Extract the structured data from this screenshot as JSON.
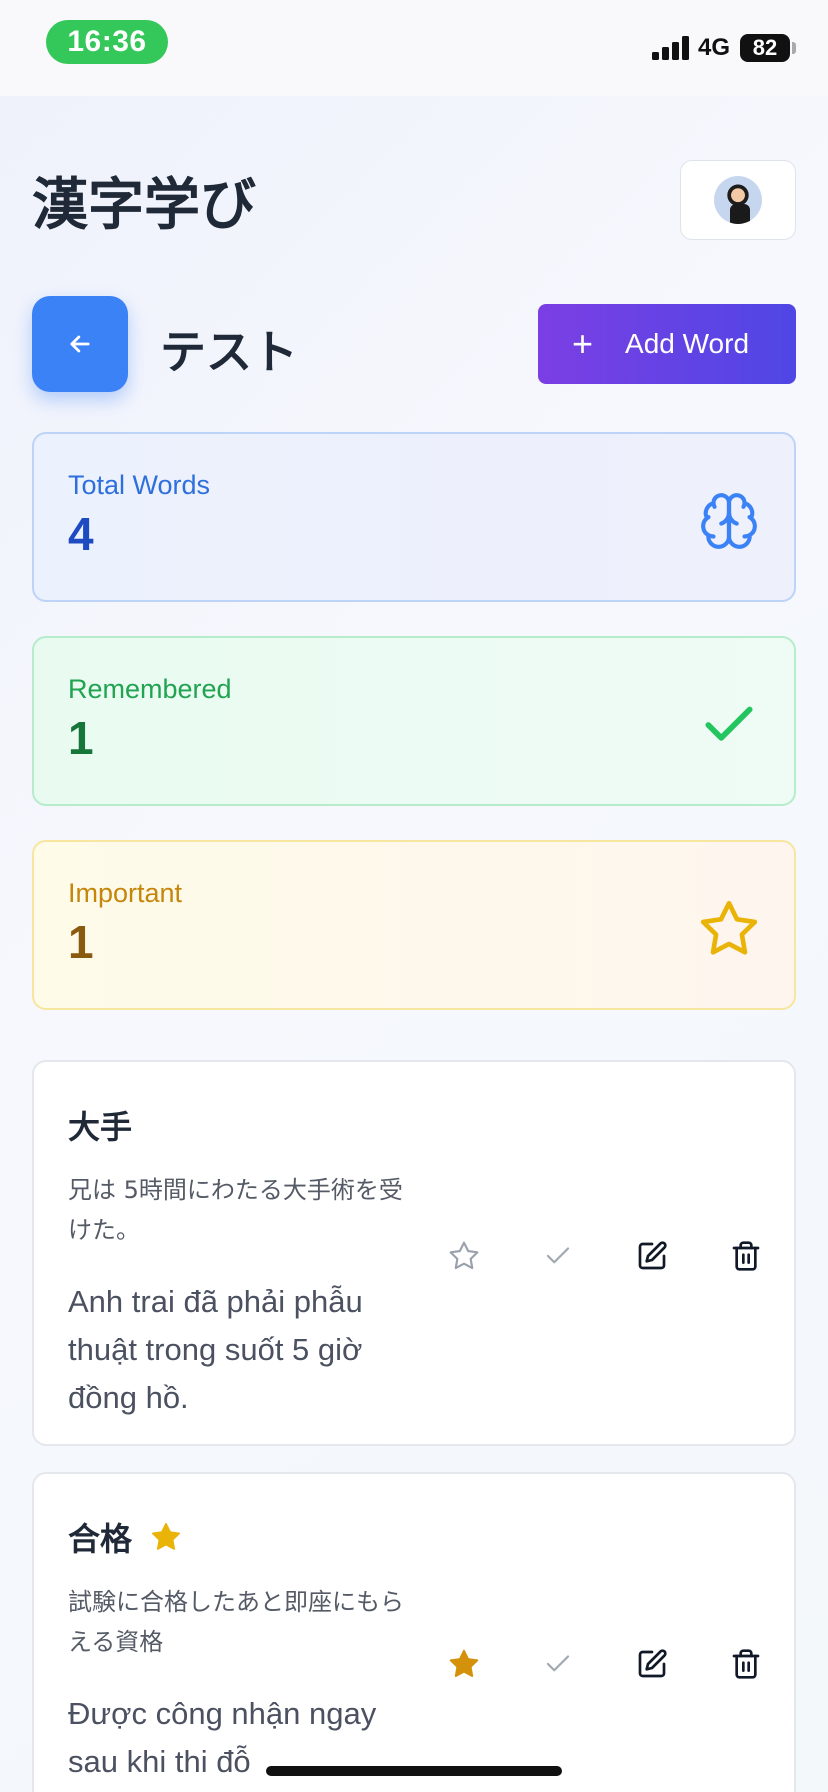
{
  "status_bar": {
    "time": "16:36",
    "network": "4G",
    "battery": "82"
  },
  "header": {
    "title": "漢字学び"
  },
  "deck": {
    "title": "テスト",
    "add_word_label": "Add Word"
  },
  "stats": {
    "total": {
      "label": "Total Words",
      "value": "4",
      "icon": "brain-icon"
    },
    "remembered": {
      "label": "Remembered",
      "value": "1",
      "icon": "check-icon"
    },
    "important": {
      "label": "Important",
      "value": "1",
      "icon": "star-icon"
    }
  },
  "words": [
    {
      "kanji": "大手",
      "important": false,
      "example": "兄は 5時間にわたる大手術を受けた。",
      "meaning": "Anh trai đã phải phẫu thuật trong suốt 5 giờ đồng hồ."
    },
    {
      "kanji": "合格",
      "important": true,
      "example": "試験に合格したあと即座にもらえる資格",
      "meaning": "Được công nhận ngay sau khi thi đỗ"
    }
  ],
  "colors": {
    "primary_blue": "#3b82f6",
    "accent_purple": "#7b3fe4",
    "accent_indigo": "#4f46e5",
    "success_green": "#22c55e",
    "warning_yellow": "#eab308",
    "star_filled": "#d4920a"
  }
}
